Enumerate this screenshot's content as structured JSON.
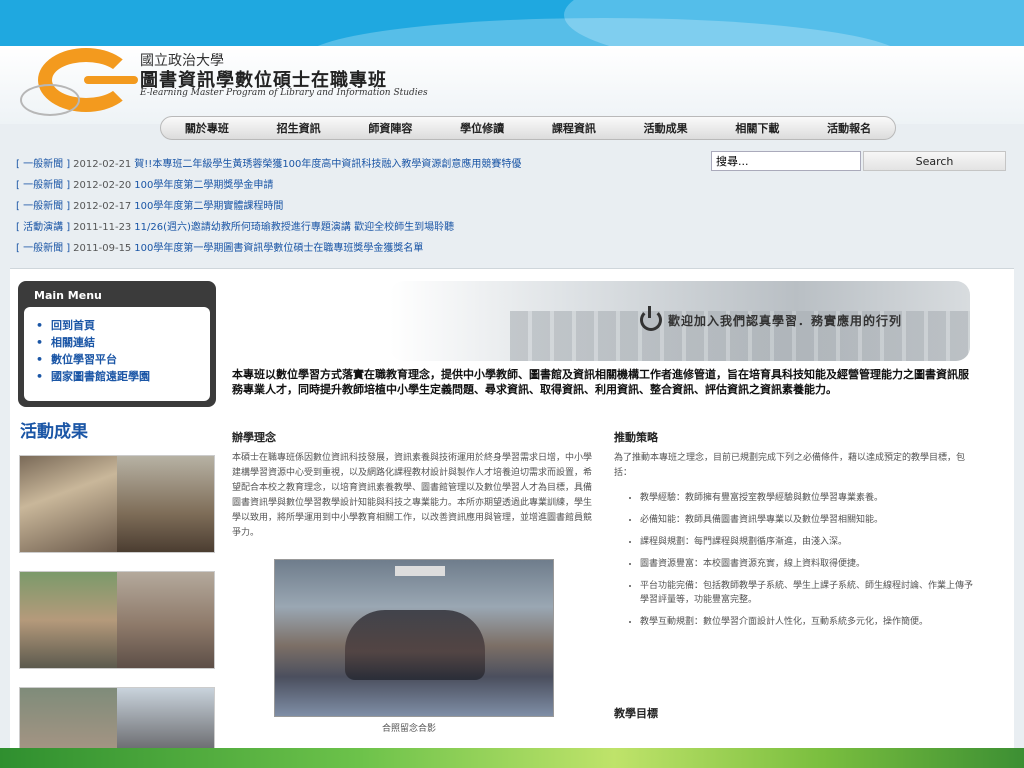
{
  "header": {
    "univ": "國立政治大學",
    "program": "圖書資訊學數位碩士在職專班",
    "program_en": "E-learning Master Program of Library and Information Studies"
  },
  "nav": [
    "關於專班",
    "招生資訊",
    "師資陣容",
    "學位修讀",
    "課程資訊",
    "活動成果",
    "相關下載",
    "活動報名"
  ],
  "news": [
    {
      "cat": "[ 一般新聞 ]",
      "date": "2012-02-21",
      "title": "賀!!本專班二年級學生黃琇蓉榮獲100年度高中資訊科技融入教學資源創意應用競賽特優"
    },
    {
      "cat": "[ 一般新聞 ]",
      "date": "2012-02-20",
      "title": "100學年度第二學期獎學金申請"
    },
    {
      "cat": "[ 一般新聞 ]",
      "date": "2012-02-17",
      "title": "100學年度第二學期實體課程時間"
    },
    {
      "cat": "[ 活動演講 ]",
      "date": "2011-11-23",
      "title": "11/26(週六)邀請幼教所何琦瑜教授進行專題演講 歡迎全校師生到場聆聽"
    },
    {
      "cat": "[ 一般新聞 ]",
      "date": "2011-09-15",
      "title": "100學年度第一學期圖書資訊學數位碩士在職專班獎學金獲獎名單"
    }
  ],
  "search": {
    "placeholder": "搜尋...",
    "button": "Search"
  },
  "menu": {
    "title": "Main Menu",
    "items": [
      "回到首頁",
      "相關連結",
      "數位學習平台",
      "國家圖書館遠距學園"
    ]
  },
  "activities_title": "活動成果",
  "banner_text": "歡迎加入我們認真學習．務實應用的行列",
  "intro": "本專班以數位學習方式落實在職教育理念，提供中小學教師、圖書館及資訊相關機構工作者進修管道，旨在培育具科技知能及經營管理能力之圖書資訊服務專業人才，同時提升教師培植中小學生定義問題、尋求資訊、取得資訊、利用資訊、整合資訊、評估資訊之資訊素養能力。",
  "left_col": {
    "heading": "辦學理念",
    "body": "本碩士在職專班係因數位資訊科技發展，資訊素養與技術運用於終身學習需求日增，中小學建構學習資源中心受到重視，以及網路化課程教材設計與製作人才培養迫切需求而設置，希望配合本校之教育理念，以培育資訊素養教學、圖書館管理以及數位學習人才為目標，具備圖書資訊學與數位學習教學設計知能與科技之專業能力。本所亦期望透過此專業訓練，學生學以致用，將所學運用到中小學教育相關工作，以改善資訊應用與管理，並增進圖書館員競爭力。",
    "caption": "合照留念合影"
  },
  "right_col": {
    "heading": "推動策略",
    "body": "為了推動本專班之理念，目前已規劃完成下列之必備條件，藉以達成預定的教學目標，包括：",
    "items": [
      "教學經驗：教師擁有豐富授室教學經驗與數位學習專業素養。",
      "必備知能：教師具備圖書資訊學專業以及數位學習相關知能。",
      "課程與規劃：每門課程與規劃循序漸進，由淺入深。",
      "圖書資源豐富：本校圖書資源充實，線上資料取得便捷。",
      "平台功能完備：包括教師教學子系統、學生上課子系統、師生線程討論、作業上傳予學習評量等，功能豐富完整。",
      "教學互動規劃：數位學習介面設計人性化，互動系統多元化，操作簡便。"
    ],
    "heading2": "教學目標"
  }
}
